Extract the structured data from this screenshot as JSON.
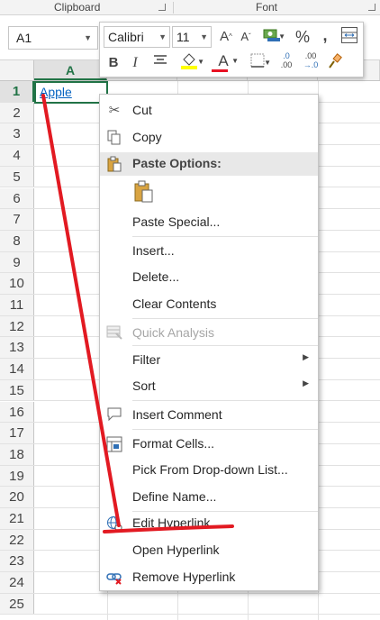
{
  "ribbon": {
    "clipboard_label": "Clipboard",
    "font_label": "Font"
  },
  "name_box": {
    "value": "A1"
  },
  "grid": {
    "active_column": "A",
    "rows": [
      "1",
      "2",
      "3",
      "4",
      "5",
      "6",
      "7",
      "8",
      "9",
      "10",
      "11",
      "12",
      "13",
      "14",
      "15",
      "16",
      "17",
      "18",
      "19",
      "20",
      "21",
      "22",
      "23",
      "24",
      "25"
    ],
    "cell_a1": "Apple"
  },
  "mini_toolbar": {
    "font_name": "Calibri",
    "font_size": "11",
    "grow_font": "A",
    "shrink_font": "A",
    "percent": "%",
    "comma": ",",
    "bold": "B",
    "italic": "I",
    "font_color_letter": "A",
    "increase_decimal_top": ".0",
    "increase_decimal_bottom": ".00",
    "decrease_decimal_top": ".00",
    "decrease_decimal_bottom": "→.0",
    "font_color": "#e81123",
    "highlight_color": "#ffff00"
  },
  "context_menu": {
    "items": [
      {
        "label": "Cut",
        "icon": "scissors-icon"
      },
      {
        "label": "Copy",
        "icon": "copy-icon"
      },
      {
        "label": "Paste Options:",
        "icon": "paste-icon"
      },
      {
        "label": "Paste Special...",
        "icon": ""
      },
      {
        "label": "Insert...",
        "icon": ""
      },
      {
        "label": "Delete...",
        "icon": ""
      },
      {
        "label": "Clear Contents",
        "icon": ""
      },
      {
        "label": "Quick Analysis",
        "icon": "quick-analysis-icon"
      },
      {
        "label": "Filter",
        "icon": ""
      },
      {
        "label": "Sort",
        "icon": ""
      },
      {
        "label": "Insert Comment",
        "icon": "comment-icon"
      },
      {
        "label": "Format Cells...",
        "icon": "format-cells-icon"
      },
      {
        "label": "Pick From Drop-down List...",
        "icon": ""
      },
      {
        "label": "Define Name...",
        "icon": ""
      },
      {
        "label": "Edit Hyperlink...",
        "icon": "globe-link-icon"
      },
      {
        "label": "Open Hyperlink",
        "icon": ""
      },
      {
        "label": "Remove Hyperlink",
        "icon": "remove-link-icon"
      }
    ]
  },
  "colors": {
    "excel_green": "#217346",
    "hyperlink_blue": "#0563c1",
    "annotation_red": "#e21a22"
  }
}
